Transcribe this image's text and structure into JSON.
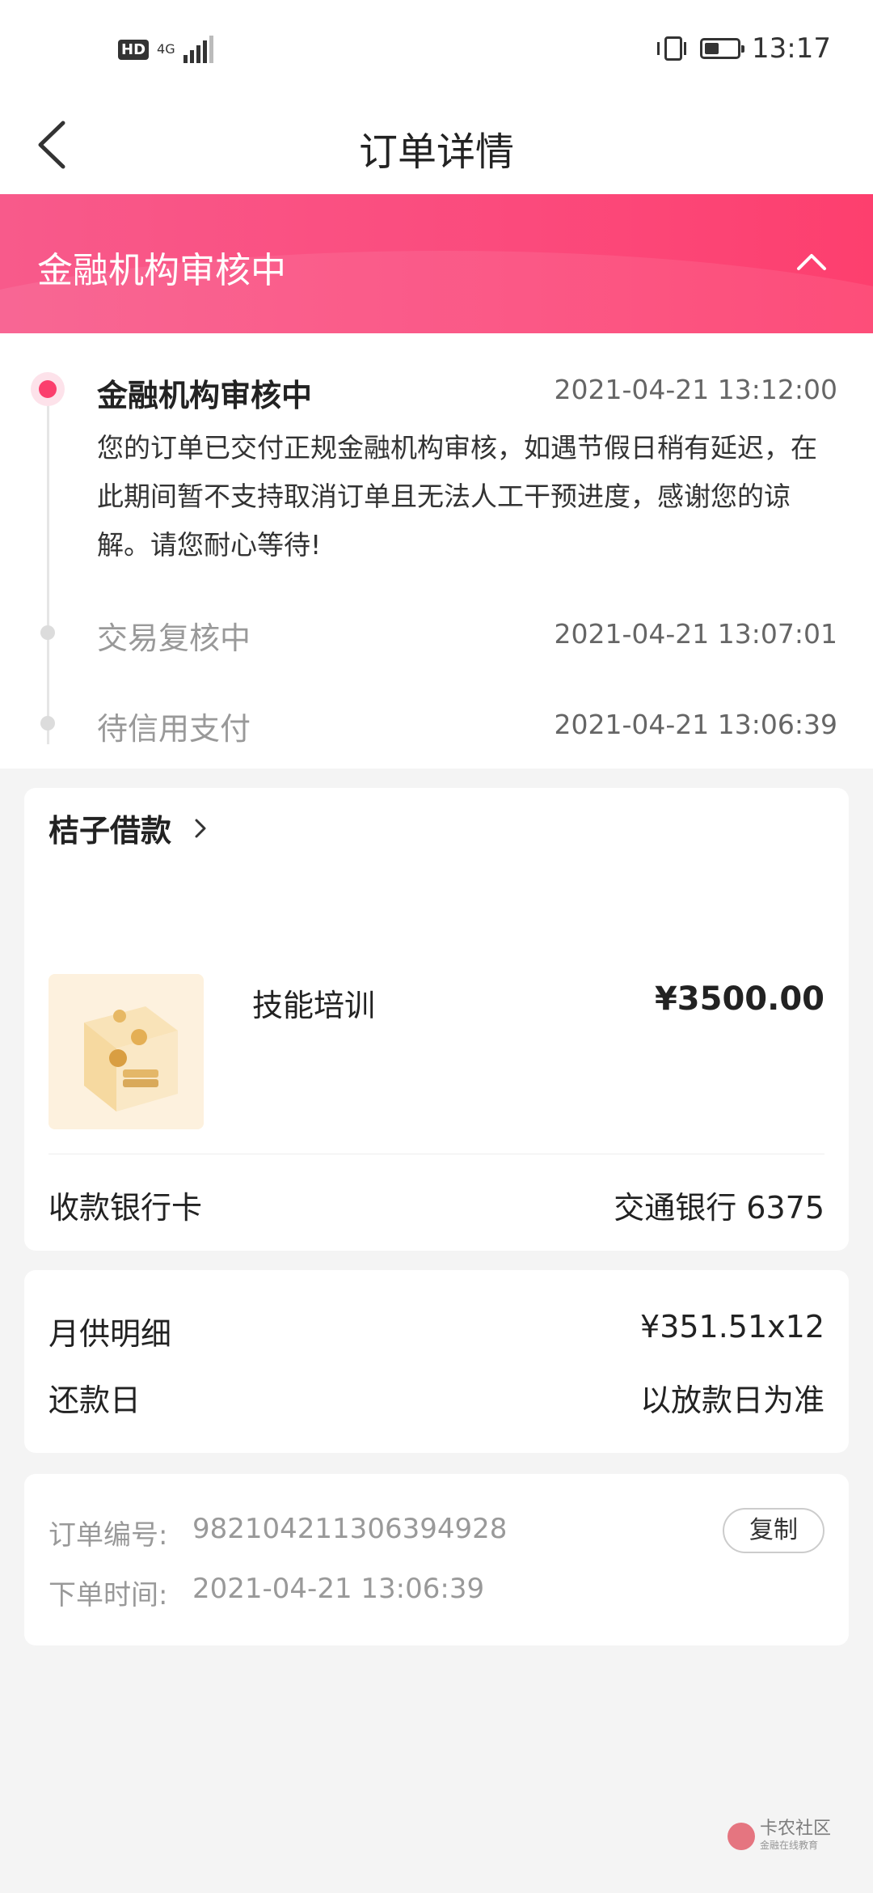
{
  "status_bar": {
    "hd_badge": "HD",
    "network": "4G",
    "time": "13:17",
    "battery_level": 0.45
  },
  "header": {
    "title": "订单详情"
  },
  "banner": {
    "title": "金融机构审核中"
  },
  "timeline": {
    "steps": [
      {
        "title": "金融机构审核中",
        "time": "2021-04-21 13:12:00",
        "description": "您的订单已交付正规金融机构审核，如遇节假日稍有延迟，在此期间暂不支持取消订单且无法人工干预进度，感谢您的谅解。请您耐心等待!"
      },
      {
        "title": "交易复核中",
        "time": "2021-04-21 13:07:01"
      },
      {
        "title": "待信用支付",
        "time": "2021-04-21 13:06:39"
      }
    ]
  },
  "order_card": {
    "merchant": "桔子借款",
    "product_name": "技能培训",
    "price": "¥3500.00",
    "bank_label": "收款银行卡",
    "bank_value": "交通银行 6375"
  },
  "repayment_card": {
    "monthly_label": "月供明细",
    "monthly_value": "¥351.51x12",
    "due_label": "还款日",
    "due_value": "以放款日为准"
  },
  "meta_card": {
    "order_no_label": "订单编号:",
    "order_no_value": "982104211306394928",
    "copy_label": "复制",
    "order_time_label": "下单时间:",
    "order_time_value": "2021-04-21 13:06:39"
  },
  "watermark": {
    "name": "卡农社区",
    "sub": "金融在线教育"
  },
  "colors": {
    "accent": "#fb3f6d",
    "banner_start": "#f85a8b",
    "banner_end": "#fd3f6e"
  },
  "icons": [
    "back-arrow-icon",
    "chevron-up-icon",
    "chevron-right-icon",
    "vibrate-icon",
    "battery-icon",
    "signal-icon"
  ]
}
